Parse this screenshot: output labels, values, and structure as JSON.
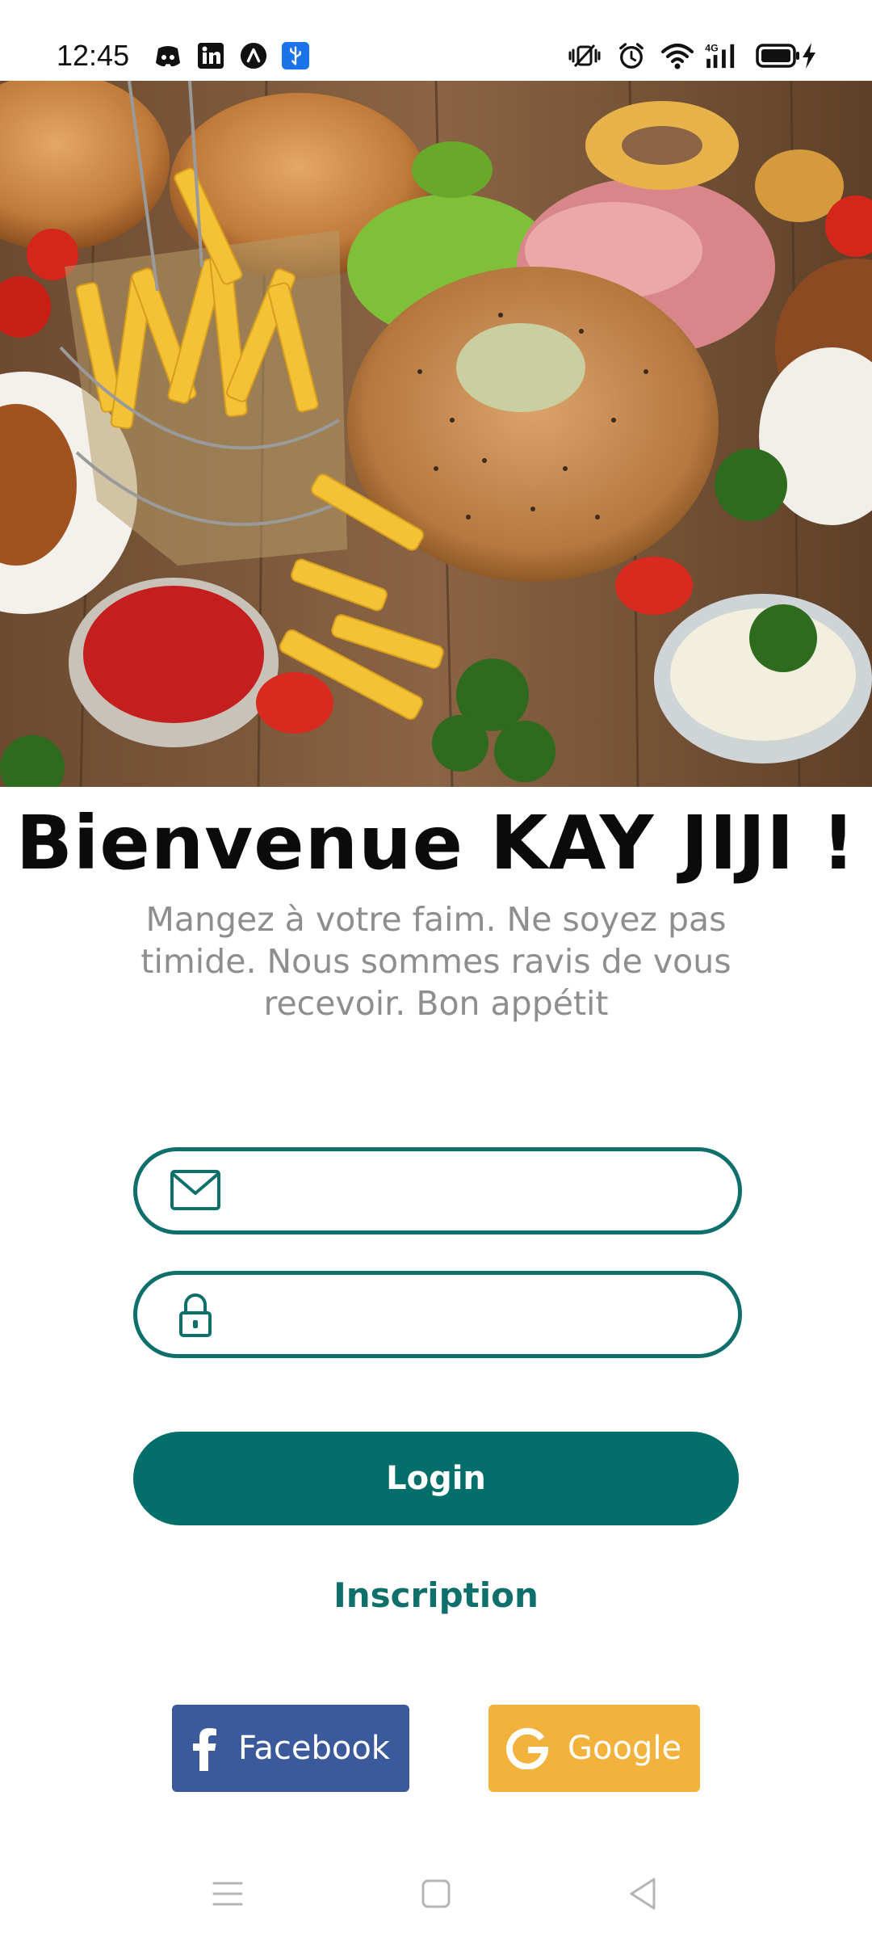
{
  "status_bar": {
    "time": "12:45",
    "left_icons": [
      "discord-icon",
      "linkedin-icon",
      "notification-app-icon",
      "usb-debug-icon"
    ],
    "right_icons": [
      "vibrate-icon",
      "alarm-icon",
      "wifi-icon",
      "signal-4g-icon",
      "battery-icon",
      "charging-icon"
    ],
    "network_label": "4G"
  },
  "hero": {
    "image": "food-photo"
  },
  "welcome": {
    "title": "Bienvenue KAY JIJI !",
    "subtitle": "Mangez à votre faim. Ne soyez pas timide. Nous sommes ravis de vous recevoir. Bon appétit"
  },
  "form": {
    "email": {
      "value": "",
      "placeholder": "",
      "icon": "mail-icon"
    },
    "password": {
      "value": "",
      "placeholder": "",
      "icon": "lock-icon"
    },
    "login_label": "Login",
    "signup_label": "Inscription"
  },
  "social": {
    "facebook_label": "Facebook",
    "google_label": "Google"
  },
  "colors": {
    "primary": "#046f6a",
    "facebook": "#3a5a9b",
    "google": "#f2b23c",
    "subtitle": "#8e8e8e"
  },
  "navigation": {
    "items": [
      "menu-icon",
      "home-icon",
      "back-icon"
    ]
  }
}
